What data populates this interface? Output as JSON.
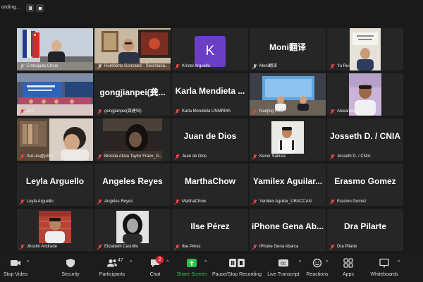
{
  "recording": {
    "label": "ording..."
  },
  "tiles": [
    {
      "name": "Embajada China",
      "muted": false,
      "big": ""
    },
    {
      "name": "Humberto Gonzalez - Secretaria...",
      "muted": false,
      "big": ""
    },
    {
      "name": "Kristel Arguello",
      "muted": true,
      "big": "",
      "avatar": "K"
    },
    {
      "name": "Moni翻译",
      "muted": false,
      "big": "Moni翻译"
    },
    {
      "name": "Yu Rui",
      "muted": true,
      "big": ""
    },
    {
      "name": "pc5",
      "muted": true,
      "big": ""
    },
    {
      "name": "gongjianpei(龚建培)",
      "muted": true,
      "big": "gongjianpei(龚..."
    },
    {
      "name": "Karla Mendieta UNMRMA",
      "muted": true,
      "big": "Karla  Mendieta ..."
    },
    {
      "name": "Nanjing FAO",
      "muted": true,
      "big": ""
    },
    {
      "name": "Alexander salmerón",
      "muted": true,
      "big": ""
    },
    {
      "name": "XuLulu@jsfao",
      "muted": true,
      "big": ""
    },
    {
      "name": "Brenda Alicia Taylor Frank_G...",
      "muted": true,
      "big": ""
    },
    {
      "name": "Juan de Dios",
      "muted": true,
      "big": "Juan de Dios"
    },
    {
      "name": "Kener Salinas",
      "muted": true,
      "big": ""
    },
    {
      "name": "Josseth D. / CNIA",
      "muted": true,
      "big": "Josseth D. / CNIA"
    },
    {
      "name": "Leyla Arguello",
      "muted": true,
      "big": "Leyla Arguello"
    },
    {
      "name": "Angeles Reyes",
      "muted": true,
      "big": "Angeles Reyes"
    },
    {
      "name": "MarthaChow",
      "muted": true,
      "big": "MarthaChow"
    },
    {
      "name": "Yamilex Aguilar_URACCAN",
      "muted": true,
      "big": "Yamilex  Aguilar..."
    },
    {
      "name": "Erasmo Gomez",
      "muted": true,
      "big": "Erasmo Gomez"
    },
    {
      "name": "Jhostin Andrade",
      "muted": true,
      "big": ""
    },
    {
      "name": "Elizabeth Castrillo",
      "muted": true,
      "big": ""
    },
    {
      "name": "Ilse Pérez",
      "muted": true,
      "big": "Ilse Pérez"
    },
    {
      "name": "iPhone Gena Abarca",
      "muted": true,
      "big": "iPhone  Gena  Ab..."
    },
    {
      "name": "Dra Pilarte",
      "muted": true,
      "big": "Dra Pilarte"
    }
  ],
  "toolbar": {
    "stop_video": "Stop Video",
    "security": "Security",
    "participants": "Participants",
    "participants_count": "47",
    "chat": "Chat",
    "chat_badge": "2",
    "share_screen": "Share Screen",
    "recording": "Pause/Stop Recording",
    "live_transcript": "Live Transcript",
    "reactions": "Reactions",
    "apps": "Apps",
    "whiteboards": "Whiteboards"
  },
  "colors": {
    "active_speaker": "#a5d549",
    "muted": "#e84545",
    "share_green": "#2ac14c",
    "badge_red": "#e0242f"
  }
}
